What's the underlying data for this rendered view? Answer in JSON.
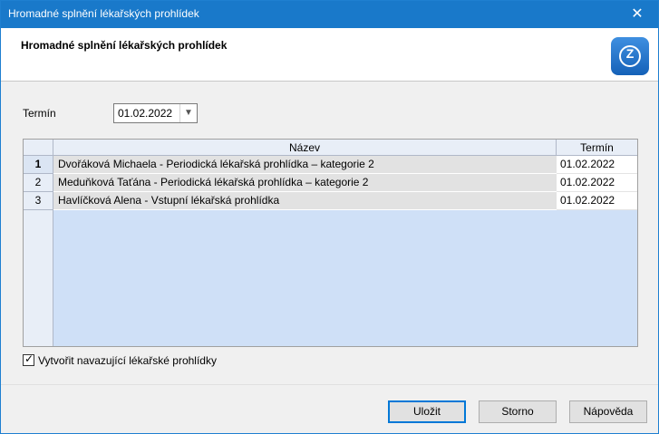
{
  "window": {
    "title": "Hromadné splnění lékařských prohlídek",
    "close_glyph": "✕"
  },
  "header": {
    "heading": "Hromadné splnění lékařských prohlídek",
    "logo_letter": "Z"
  },
  "form": {
    "termin_label": "Termín",
    "termin_value": "01.02.2022",
    "dropdown_glyph": "▼"
  },
  "grid": {
    "columns": {
      "name": "Název",
      "date": "Termín"
    },
    "rows": [
      {
        "num": "1",
        "name": "Dvořáková Michaela - Periodická lékařská prohlídka – kategorie 2",
        "date": "01.02.2022"
      },
      {
        "num": "2",
        "name": "Meduňková Taťána - Periodická lékařská prohlídka – kategorie 2",
        "date": "01.02.2022"
      },
      {
        "num": "3",
        "name": "Havlíčková Alena - Vstupní lékařská prohlídka",
        "date": "01.02.2022"
      }
    ]
  },
  "checkbox": {
    "label": "Vytvořit navazující lékařské prohlídky",
    "checked": true,
    "check_glyph": "✓"
  },
  "buttons": {
    "save": "Uložit",
    "cancel": "Storno",
    "help": "Nápověda"
  }
}
